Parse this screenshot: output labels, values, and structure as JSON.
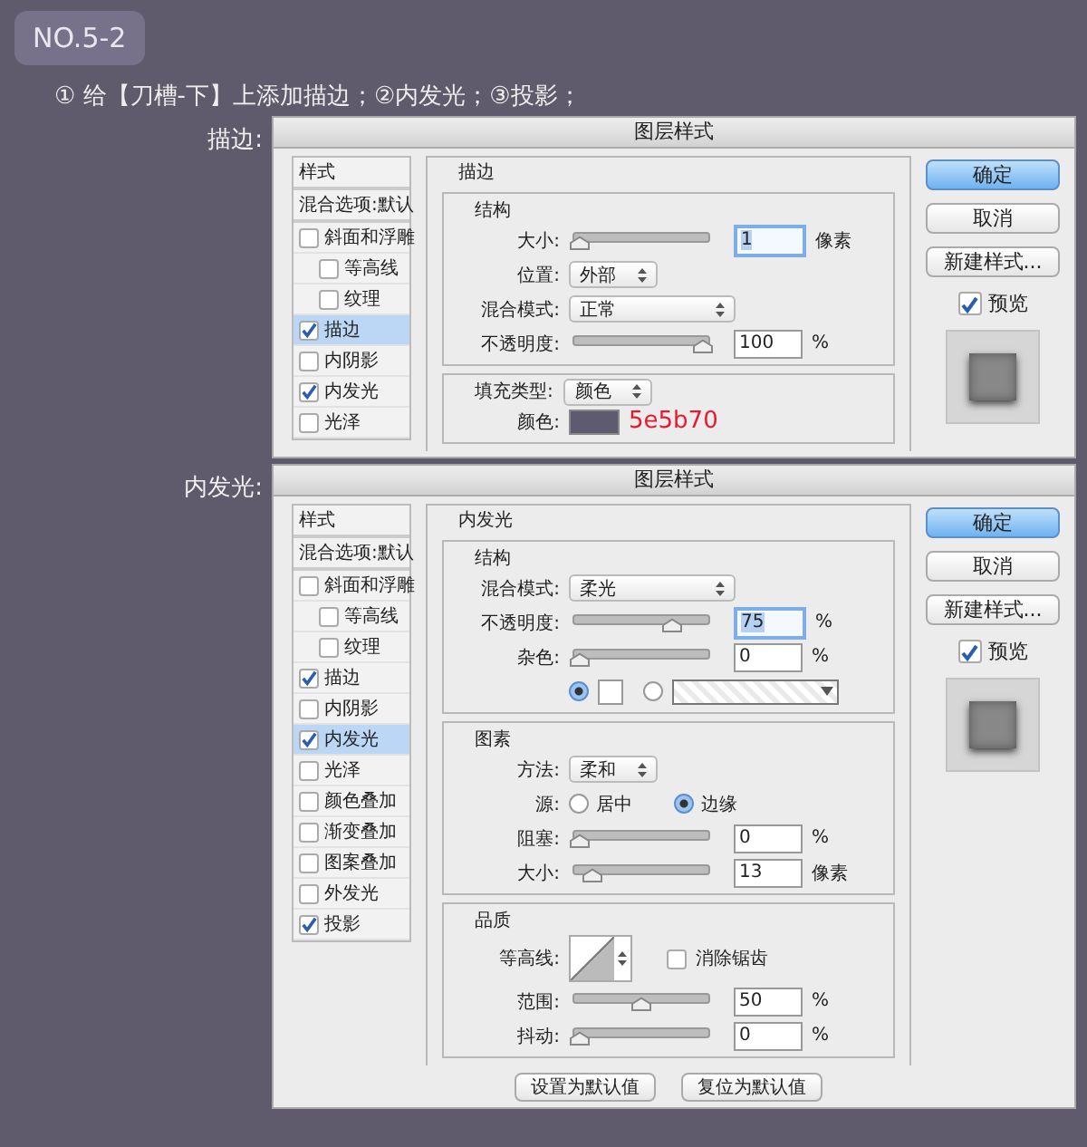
{
  "badge": "NO.5-2",
  "instruction": "① 给【刀槽-下】上添加描边；②内发光；③投影；",
  "dialogs": [
    {
      "caption": "描边:",
      "title": "图层样式",
      "styles": [
        {
          "kind": "header",
          "label": "样式",
          "selected": false
        },
        {
          "kind": "header",
          "label": "混合选项:默认",
          "selected": false
        },
        {
          "kind": "option",
          "label": "斜面和浮雕",
          "checked": false,
          "selected": false,
          "children": [
            {
              "kind": "option",
              "label": "等高线",
              "checked": false,
              "selected": false
            },
            {
              "kind": "option",
              "label": "纹理",
              "checked": false,
              "selected": false
            }
          ]
        },
        {
          "kind": "option",
          "label": "描边",
          "checked": true,
          "selected": true
        },
        {
          "kind": "option",
          "label": "内阴影",
          "checked": false,
          "selected": false
        },
        {
          "kind": "option",
          "label": "内发光",
          "checked": true,
          "selected": false
        },
        {
          "kind": "option",
          "label": "光泽",
          "checked": false,
          "selected": false
        }
      ],
      "panel": {
        "title": "描边",
        "groups": [
          {
            "title": "结构",
            "rows": [
              {
                "kind": "slider",
                "label": "大小:",
                "level": 0.0,
                "value": "1",
                "unit": "像素",
                "focused": true
              },
              {
                "kind": "select",
                "label": "位置:",
                "value": "外部"
              },
              {
                "kind": "select",
                "label": "混合模式:",
                "value": "正常",
                "wide": true
              },
              {
                "kind": "slider",
                "label": "不透明度:",
                "level": 1.0,
                "value": "100",
                "unit": "%",
                "focused": false
              }
            ]
          },
          {
            "title": "填充类型:",
            "title_select": "颜色",
            "rows": [
              {
                "kind": "color",
                "label": "颜色:",
                "color": "#5e5b70",
                "note": "5e5b70"
              }
            ]
          }
        ]
      },
      "buttons": [
        {
          "label": "确定",
          "default": true
        },
        {
          "label": "取消",
          "default": false
        },
        {
          "label": "新建样式...",
          "default": false
        }
      ],
      "preview": {
        "label": "预览",
        "checked": true
      }
    },
    {
      "caption": "内发光:",
      "title": "图层样式",
      "styles": [
        {
          "kind": "header",
          "label": "样式",
          "selected": false
        },
        {
          "kind": "header",
          "label": "混合选项:默认",
          "selected": false
        },
        {
          "kind": "option",
          "label": "斜面和浮雕",
          "checked": false,
          "selected": false,
          "children": [
            {
              "kind": "option",
              "label": "等高线",
              "checked": false,
              "selected": false
            },
            {
              "kind": "option",
              "label": "纹理",
              "checked": false,
              "selected": false
            }
          ]
        },
        {
          "kind": "option",
          "label": "描边",
          "checked": true,
          "selected": false
        },
        {
          "kind": "option",
          "label": "内阴影",
          "checked": false,
          "selected": false
        },
        {
          "kind": "option",
          "label": "内发光",
          "checked": true,
          "selected": true
        },
        {
          "kind": "option",
          "label": "光泽",
          "checked": false,
          "selected": false
        },
        {
          "kind": "option",
          "label": "颜色叠加",
          "checked": false,
          "selected": false
        },
        {
          "kind": "option",
          "label": "渐变叠加",
          "checked": false,
          "selected": false
        },
        {
          "kind": "option",
          "label": "图案叠加",
          "checked": false,
          "selected": false
        },
        {
          "kind": "option",
          "label": "外发光",
          "checked": false,
          "selected": false
        },
        {
          "kind": "option",
          "label": "投影",
          "checked": true,
          "selected": false
        }
      ],
      "panel": {
        "title": "内发光",
        "groups": [
          {
            "title": "结构",
            "rows": [
              {
                "kind": "select",
                "label": "混合模式:",
                "value": "柔光",
                "wide": true
              },
              {
                "kind": "slider",
                "label": "不透明度:",
                "level": 0.75,
                "value": "75",
                "unit": "%",
                "focused": true
              },
              {
                "kind": "slider",
                "label": "杂色:",
                "level": 0.0,
                "value": "0",
                "unit": "%",
                "focused": false
              },
              {
                "kind": "fill_choice",
                "options": [
                  {
                    "kind": "swatch",
                    "selected": true
                  },
                  {
                    "kind": "gradient",
                    "selected": false
                  }
                ]
              }
            ]
          },
          {
            "title": "图素",
            "rows": [
              {
                "kind": "select",
                "label": "方法:",
                "value": "柔和"
              },
              {
                "kind": "radios",
                "label": "源:",
                "options": [
                  {
                    "label": "居中",
                    "selected": false
                  },
                  {
                    "label": "边缘",
                    "selected": true
                  }
                ]
              },
              {
                "kind": "slider",
                "label": "阻塞:",
                "level": 0.0,
                "value": "0",
                "unit": "%",
                "focused": false
              },
              {
                "kind": "slider",
                "label": "大小:",
                "level": 0.1,
                "value": "13",
                "unit": "像素",
                "focused": false
              }
            ]
          },
          {
            "title": "品质",
            "rows": [
              {
                "kind": "contour",
                "label": "等高线:",
                "checkbox": {
                  "label": "消除锯齿",
                  "checked": false
                }
              },
              {
                "kind": "slider",
                "label": "范围:",
                "level": 0.5,
                "value": "50",
                "unit": "%",
                "focused": false
              },
              {
                "kind": "slider",
                "label": "抖动:",
                "level": 0.0,
                "value": "0",
                "unit": "%",
                "focused": false
              }
            ]
          }
        ],
        "footer_buttons": [
          "设置为默认值",
          "复位为默认值"
        ]
      },
      "buttons": [
        {
          "label": "确定",
          "default": true
        },
        {
          "label": "取消",
          "default": false
        },
        {
          "label": "新建样式...",
          "default": false
        }
      ],
      "preview": {
        "label": "预览",
        "checked": true
      }
    }
  ]
}
